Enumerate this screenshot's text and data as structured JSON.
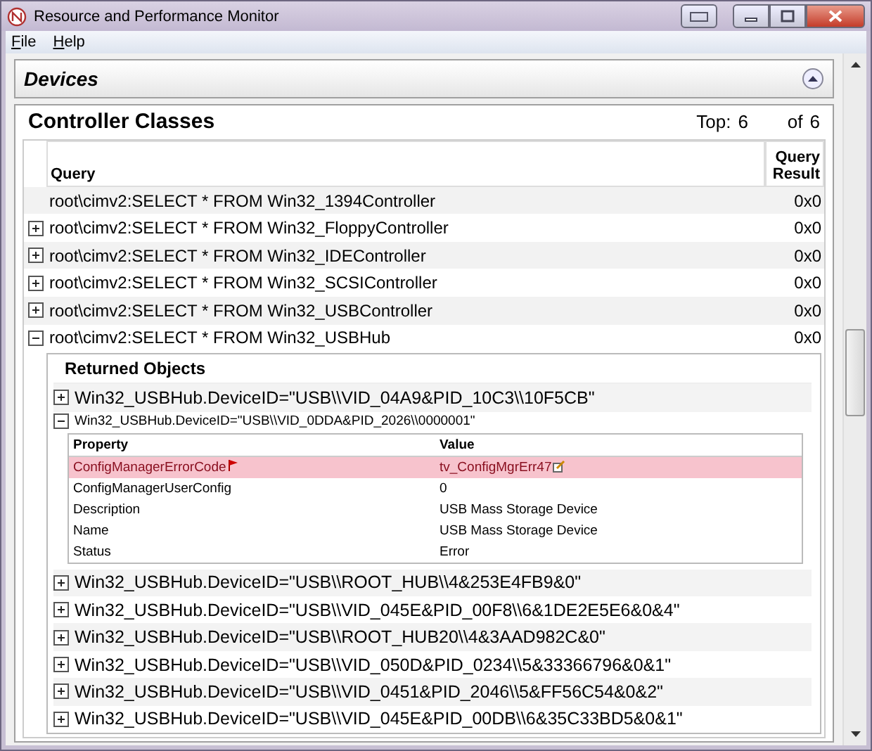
{
  "window": {
    "title": "Resource and Performance Monitor"
  },
  "menu": [
    {
      "label": "File"
    },
    {
      "label": "Help"
    }
  ],
  "section": {
    "title": "Devices",
    "expanded": true
  },
  "panel": {
    "title": "Controller Classes",
    "top_label": "Top:",
    "top_value": "6",
    "of_label": "of",
    "of_value": "6",
    "columns": [
      "Query",
      "Query Result"
    ],
    "rows": [
      {
        "query": "root\\cimv2:SELECT * FROM Win32_1394Controller",
        "result": "0x0",
        "expandable": false,
        "expanded": false
      },
      {
        "query": "root\\cimv2:SELECT * FROM Win32_FloppyController",
        "result": "0x0",
        "expandable": true,
        "expanded": false
      },
      {
        "query": "root\\cimv2:SELECT * FROM Win32_IDEController",
        "result": "0x0",
        "expandable": true,
        "expanded": false
      },
      {
        "query": "root\\cimv2:SELECT * FROM Win32_SCSIController",
        "result": "0x0",
        "expandable": true,
        "expanded": false
      },
      {
        "query": "root\\cimv2:SELECT * FROM Win32_USBController",
        "result": "0x0",
        "expandable": true,
        "expanded": false
      },
      {
        "query": "root\\cimv2:SELECT * FROM Win32_USBHub",
        "result": "0x0",
        "expandable": true,
        "expanded": true
      }
    ],
    "returned": {
      "title": "Returned Objects",
      "objects": [
        {
          "label": "Win32_USBHub.DeviceID=\"USB\\\\VID_04A9&PID_10C3\\\\10F5CB\"",
          "expanded": false
        },
        {
          "label": "Win32_USBHub.DeviceID=\"USB\\\\VID_0DDA&PID_2026\\\\0000001\"",
          "expanded": true,
          "property_columns": [
            "Property",
            "Value"
          ],
          "properties": [
            {
              "property": "ConfigManagerErrorCode",
              "value": "tv_ConfigMgrErr47",
              "error": true
            },
            {
              "property": "ConfigManagerUserConfig",
              "value": "0",
              "error": false
            },
            {
              "property": "Description",
              "value": "USB Mass Storage Device",
              "error": false
            },
            {
              "property": "Name",
              "value": "USB Mass Storage Device",
              "error": false
            },
            {
              "property": "Status",
              "value": "Error",
              "error": false
            }
          ]
        },
        {
          "label": "Win32_USBHub.DeviceID=\"USB\\\\ROOT_HUB\\\\4&253E4FB9&0\"",
          "expanded": false
        },
        {
          "label": "Win32_USBHub.DeviceID=\"USB\\\\VID_045E&PID_00F8\\\\6&1DE2E5E6&0&4\"",
          "expanded": false
        },
        {
          "label": "Win32_USBHub.DeviceID=\"USB\\\\ROOT_HUB20\\\\4&3AAD982C&0\"",
          "expanded": false
        },
        {
          "label": "Win32_USBHub.DeviceID=\"USB\\\\VID_050D&PID_0234\\\\5&33366796&0&1\"",
          "expanded": false
        },
        {
          "label": "Win32_USBHub.DeviceID=\"USB\\\\VID_0451&PID_2046\\\\5&FF56C54&0&2\"",
          "expanded": false
        },
        {
          "label": "Win32_USBHub.DeviceID=\"USB\\\\VID_045E&PID_00DB\\\\6&35C33BD5&0&1\"",
          "expanded": false
        }
      ]
    }
  }
}
